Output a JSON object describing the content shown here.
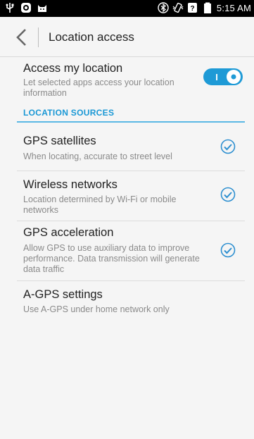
{
  "status_bar": {
    "time": "5:15 AM",
    "left_icons": [
      "usb-icon",
      "app-notification-icon",
      "cat-notification-icon"
    ],
    "right_icons": [
      "bluetooth-icon",
      "vibrate-icon",
      "signal-icon",
      "battery-icon"
    ]
  },
  "action_bar": {
    "back_icon": "chevron-left-icon",
    "title": "Location access"
  },
  "access_location": {
    "title": "Access my location",
    "summary": "Let selected apps access your location information",
    "toggle_label": "I",
    "enabled": true
  },
  "location_sources": {
    "header": "LOCATION SOURCES",
    "items": [
      {
        "title": "GPS satellites",
        "summary": "When locating, accurate to street level",
        "checked": true
      },
      {
        "title": "Wireless networks",
        "summary": "Location determined by Wi-Fi or mobile networks",
        "checked": true
      },
      {
        "title": "GPS acceleration",
        "summary": "Allow GPS to use auxiliary data to improve performance. Data transmission will generate data traffic",
        "checked": true
      }
    ]
  },
  "agps_settings": {
    "title": "A-GPS settings",
    "summary": "Use A-GPS under home network only"
  },
  "colors": {
    "accent": "#1a98d5",
    "toggle_on": "#1e9ad6",
    "checkmark": "#2d8fd0"
  }
}
